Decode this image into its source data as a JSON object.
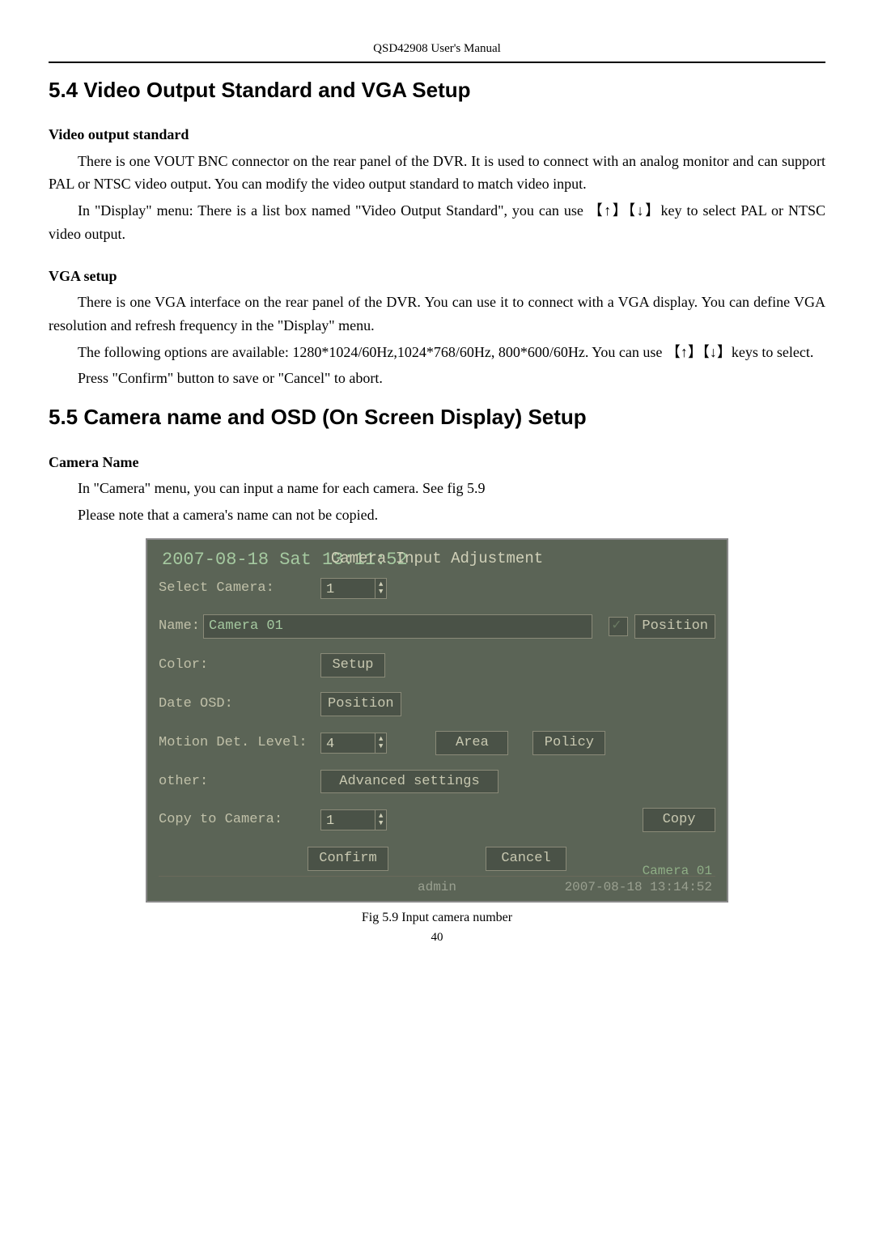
{
  "header": "QSD42908 User's Manual",
  "section54": {
    "title": "5.4    Video Output Standard and VGA Setup",
    "sub1": "Video output standard",
    "p1": "There is one VOUT BNC connector on the rear panel of the DVR. It is used to connect with an analog monitor and can support PAL or NTSC video output. You can modify the video output standard to match video input.",
    "p2": "In \"Display\" menu: There is a list box named \"Video Output Standard\", you can use 【↑】【↓】key to select PAL or NTSC video output.",
    "sub2": "VGA setup",
    "p3": "There is one VGA interface on the rear panel of the DVR. You can use it to connect with a VGA display. You can define VGA resolution and refresh frequency in the \"Display\" menu.",
    "p4": "The following options are available: 1280*1024/60Hz,1024*768/60Hz, 800*600/60Hz. You can use 【↑】【↓】keys to select.",
    "p5": "Press \"Confirm\" button to save or \"Cancel\" to abort."
  },
  "section55": {
    "title": "5.5 Camera name and OSD (On Screen Display) Setup",
    "sub1": "Camera Name",
    "p1": "In \"Camera\" menu, you can input a name for each camera. See fig 5.9",
    "p2": "Please note that a camera's name can not be copied."
  },
  "screenshot": {
    "bg_date": "2007-08-18 Sat 13:11:52",
    "title": "Camera Input Adjustment",
    "select_camera_label": "Select Camera:",
    "select_camera_value": "1",
    "name_label": "Name:",
    "name_value": "Camera 01",
    "position_btn": "Position",
    "color_label": "Color:",
    "setup_btn": "Setup",
    "date_osd_label": "Date OSD:",
    "date_osd_btn": "Position",
    "motion_label": "Motion Det. Level:",
    "motion_value": "4",
    "area_btn": "Area",
    "policy_btn": "Policy",
    "other_label": "other:",
    "advanced_btn": "Advanced settings",
    "copy_to_label": "Copy to Camera:",
    "copy_to_value": "1",
    "copy_btn": "Copy",
    "confirm_btn": "Confirm",
    "cancel_btn": "Cancel",
    "status_user": "admin",
    "status_overlay": "Camera 01",
    "status_time": "2007-08-18 13:14:52"
  },
  "caption": "Fig 5.9 Input camera number",
  "page_number": "40"
}
